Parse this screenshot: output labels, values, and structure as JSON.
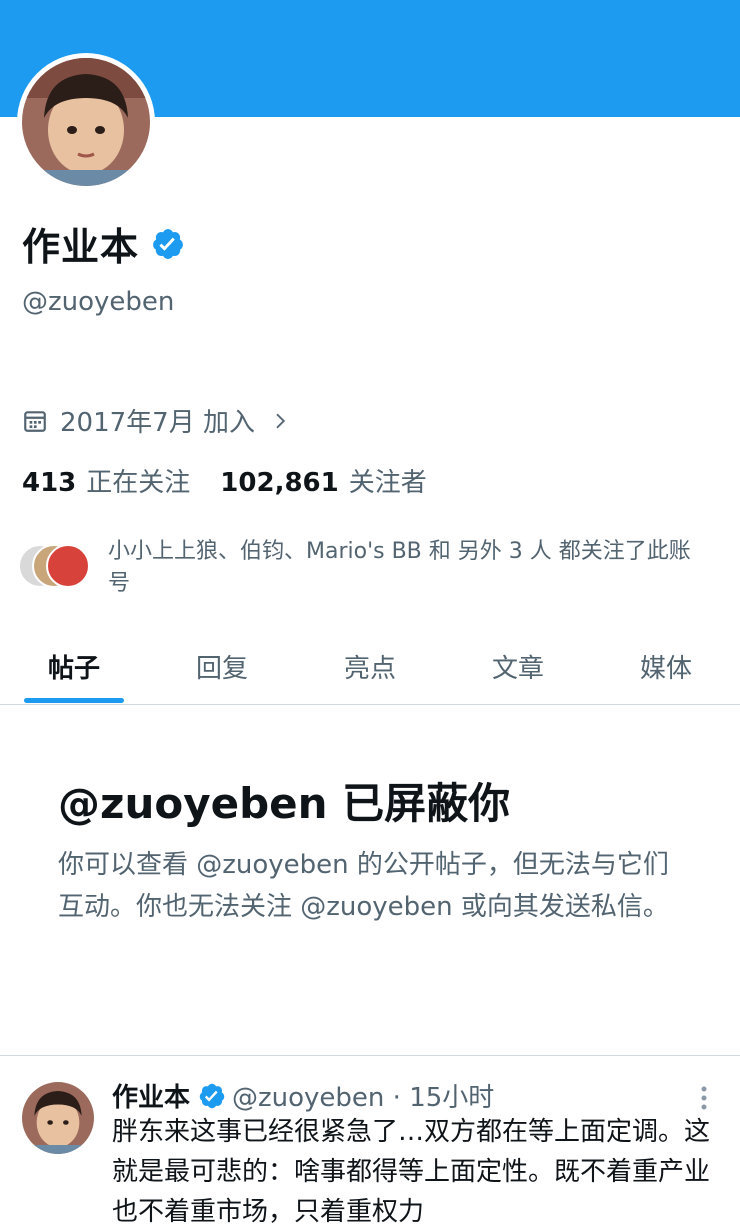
{
  "profile": {
    "display_name": "作业本",
    "handle": "@zuoyeben",
    "joined": "2017年7月 加入",
    "following_count": "413",
    "following_label": "正在关注",
    "followers_count": "102,861",
    "followers_label": "关注者",
    "followers_you_know": "小小上上狼、伯钧、Mario's BB 和 另外 3 人 都关注了此账号"
  },
  "tabs": [
    "帖子",
    "回复",
    "亮点",
    "文章",
    "媒体"
  ],
  "blocked": {
    "title": "@zuoyeben 已屏蔽你",
    "description": "你可以查看 @zuoyeben 的公开帖子，但无法与它们互动。你也无法关注 @zuoyeben 或向其发送私信。"
  },
  "tweet": {
    "name": "作业本",
    "handle_time": "@zuoyeben · 15小时",
    "text": "胖东来这事已经很紧急了…双方都在等上面定调。这就是最可悲的：啥事都得等上面定性。既不着重产业也不着重市场，只着重权力"
  },
  "colors": {
    "accent": "#1d9bf0",
    "text_primary": "#0f1419",
    "text_secondary": "#536471",
    "border": "#cfd9de"
  },
  "icons": {
    "verified": "verified-badge-icon",
    "calendar": "calendar-icon",
    "chevron": "chevron-right-icon",
    "more": "more-vertical-icon"
  }
}
